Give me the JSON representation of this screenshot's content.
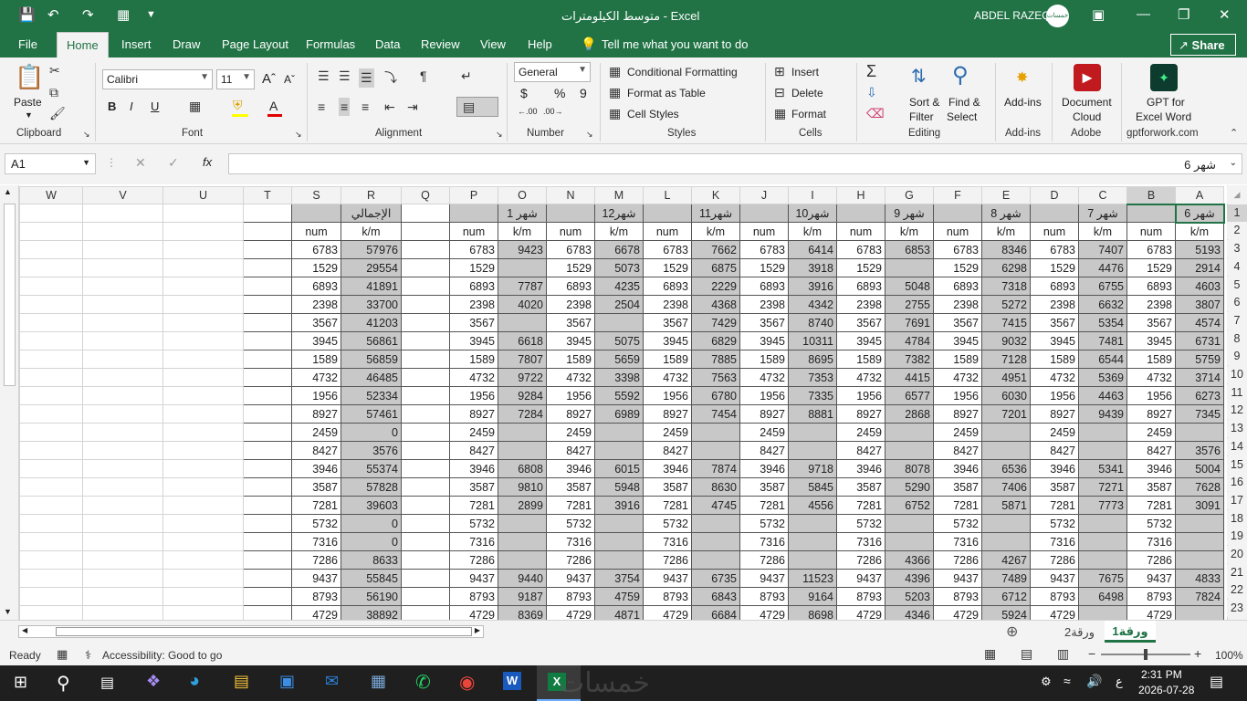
{
  "window": {
    "title": "متوسط الكيلومترات  -  Excel",
    "user": "ABDEL RAZEQ",
    "avatar_text": "خمسات"
  },
  "tabs": [
    "File",
    "Home",
    "Insert",
    "Draw",
    "Page Layout",
    "Formulas",
    "Data",
    "Review",
    "View",
    "Help"
  ],
  "tell_me": "Tell me what you want to do",
  "share": "Share",
  "ribbon": {
    "clipboard": {
      "paste": "Paste",
      "label": "Clipboard"
    },
    "font": {
      "name": "Calibri",
      "size": "11",
      "label": "Font"
    },
    "alignment": {
      "label": "Alignment"
    },
    "number": {
      "format": "General",
      "label": "Number",
      "currency": "$",
      "percent": "%",
      "comma": "9"
    },
    "styles": {
      "cond": "Conditional Formatting",
      "table": "Format as Table",
      "cell": "Cell Styles",
      "label": "Styles"
    },
    "cells": {
      "insert": "Insert",
      "delete": "Delete",
      "format": "Format",
      "label": "Cells"
    },
    "editing": {
      "sort1": "Sort &",
      "sort2": "Filter",
      "find1": "Find &",
      "find2": "Select",
      "label": "Editing"
    },
    "addins": {
      "btn": "Add-ins",
      "label": "Add-ins"
    },
    "adobe": {
      "btn1": "Document",
      "btn2": "Cloud",
      "label": "Adobe"
    },
    "gpt": {
      "btn1": "GPT for",
      "btn2": "Excel Word",
      "label": "gptforwork.com"
    }
  },
  "formula_bar": {
    "name_box": "A1",
    "fx": "fx",
    "content": "شهر 6"
  },
  "columns": [
    "W",
    "V",
    "U",
    "T",
    "S",
    "R",
    "Q",
    "P",
    "O",
    "N",
    "M",
    "L",
    "K",
    "J",
    "I",
    "H",
    "G",
    "F",
    "E",
    "D",
    "C",
    "B",
    "A"
  ],
  "row1": [
    "",
    "",
    "",
    "",
    "",
    "الإجمالي",
    "",
    "",
    "شهر 1",
    "",
    "شهر12",
    "",
    "شهر11",
    "",
    "شهر10",
    "",
    "شهر 9",
    "",
    "شهر 8",
    "",
    "شهر 7",
    "",
    "شهر 6"
  ],
  "row2": [
    "",
    "",
    "",
    "",
    "num",
    "k/m",
    "",
    "num",
    "k/m",
    "num",
    "k/m",
    "num",
    "k/m",
    "num",
    "k/m",
    "num",
    "k/m",
    "num",
    "k/m",
    "num",
    "k/m",
    "num",
    "k/m"
  ],
  "rows": [
    {
      "n": "3",
      "num": "6783",
      "tot": "57976",
      "P": "9423",
      "N": "6678",
      "L": "7662",
      "J": "6414",
      "H": "6853",
      "F": "8346",
      "D": "7407",
      "B": "5193"
    },
    {
      "n": "4",
      "num": "1529",
      "tot": "29554",
      "P": "",
      "N": "5073",
      "L": "6875",
      "J": "3918",
      "H": "",
      "F": "6298",
      "D": "4476",
      "B": "2914"
    },
    {
      "n": "5",
      "num": "6893",
      "tot": "41891",
      "P": "7787",
      "N": "4235",
      "L": "2229",
      "J": "3916",
      "H": "5048",
      "F": "7318",
      "D": "6755",
      "B": "4603"
    },
    {
      "n": "6",
      "num": "2398",
      "tot": "33700",
      "P": "4020",
      "N": "2504",
      "L": "4368",
      "J": "4342",
      "H": "2755",
      "F": "5272",
      "D": "6632",
      "B": "3807"
    },
    {
      "n": "7",
      "num": "3567",
      "tot": "41203",
      "P": "",
      "N": "",
      "L": "7429",
      "J": "8740",
      "H": "7691",
      "F": "7415",
      "D": "5354",
      "B": "4574"
    },
    {
      "n": "8",
      "num": "3945",
      "tot": "56861",
      "P": "6618",
      "N": "5075",
      "L": "6829",
      "J": "10311",
      "H": "4784",
      "F": "9032",
      "D": "7481",
      "B": "6731"
    },
    {
      "n": "9",
      "num": "1589",
      "tot": "56859",
      "P": "7807",
      "N": "5659",
      "L": "7885",
      "J": "8695",
      "H": "7382",
      "F": "7128",
      "D": "6544",
      "B": "5759"
    },
    {
      "n": "10",
      "num": "4732",
      "tot": "46485",
      "P": "9722",
      "N": "3398",
      "L": "7563",
      "J": "7353",
      "H": "4415",
      "F": "4951",
      "D": "5369",
      "B": "3714"
    },
    {
      "n": "11",
      "num": "1956",
      "tot": "52334",
      "P": "9284",
      "N": "5592",
      "L": "6780",
      "J": "7335",
      "H": "6577",
      "F": "6030",
      "D": "4463",
      "B": "6273"
    },
    {
      "n": "12",
      "num": "8927",
      "tot": "57461",
      "P": "7284",
      "N": "6989",
      "L": "7454",
      "J": "8881",
      "H": "2868",
      "F": "7201",
      "D": "9439",
      "B": "7345"
    },
    {
      "n": "13",
      "num": "2459",
      "tot": "0",
      "P": "",
      "N": "",
      "L": "",
      "J": "",
      "H": "",
      "F": "",
      "D": "",
      "B": ""
    },
    {
      "n": "14",
      "num": "8427",
      "tot": "3576",
      "P": "",
      "N": "",
      "L": "",
      "J": "",
      "H": "",
      "F": "",
      "D": "",
      "B": "3576"
    },
    {
      "n": "15",
      "num": "3946",
      "tot": "55374",
      "P": "6808",
      "N": "6015",
      "L": "7874",
      "J": "9718",
      "H": "8078",
      "F": "6536",
      "D": "5341",
      "B": "5004"
    },
    {
      "n": "16",
      "num": "3587",
      "tot": "57828",
      "P": "9810",
      "N": "5948",
      "L": "8630",
      "J": "5845",
      "H": "5290",
      "F": "7406",
      "D": "7271",
      "B": "7628"
    },
    {
      "n": "17",
      "num": "7281",
      "tot": "39603",
      "P": "2899",
      "N": "3916",
      "L": "4745",
      "J": "4556",
      "H": "6752",
      "F": "5871",
      "D": "7773",
      "B": "3091"
    },
    {
      "n": "18",
      "num": "5732",
      "tot": "0",
      "P": "",
      "N": "",
      "L": "",
      "J": "",
      "H": "",
      "F": "",
      "D": "",
      "B": ""
    },
    {
      "n": "19",
      "num": "7316",
      "tot": "0",
      "P": "",
      "N": "",
      "L": "",
      "J": "",
      "H": "",
      "F": "",
      "D": "",
      "B": ""
    },
    {
      "n": "20",
      "num": "7286",
      "tot": "8633",
      "P": "",
      "N": "",
      "L": "",
      "J": "",
      "H": "4366",
      "F": "4267",
      "D": "",
      "B": ""
    },
    {
      "n": "21",
      "num": "9437",
      "tot": "55845",
      "P": "9440",
      "N": "3754",
      "L": "6735",
      "J": "11523",
      "H": "4396",
      "F": "7489",
      "D": "7675",
      "B": "4833"
    },
    {
      "n": "22",
      "num": "8793",
      "tot": "56190",
      "P": "9187",
      "N": "4759",
      "L": "6843",
      "J": "9164",
      "H": "5203",
      "F": "6712",
      "D": "6498",
      "B": "7824"
    },
    {
      "n": "23",
      "num": "4729",
      "tot": "38892",
      "P": "8369",
      "N": "4871",
      "L": "6684",
      "J": "8698",
      "H": "4346",
      "F": "5924",
      "D": "",
      "B": ""
    }
  ],
  "sheet_tabs": [
    "ورقة1",
    "ورقة2"
  ],
  "status": {
    "ready": "Ready",
    "accessibility": "Accessibility: Good to go",
    "zoom": "100%"
  },
  "taskbar": {
    "time": "2:31 PM",
    "date": "2026-07-28",
    "lang": "ع",
    "watermark": "خمسات"
  }
}
